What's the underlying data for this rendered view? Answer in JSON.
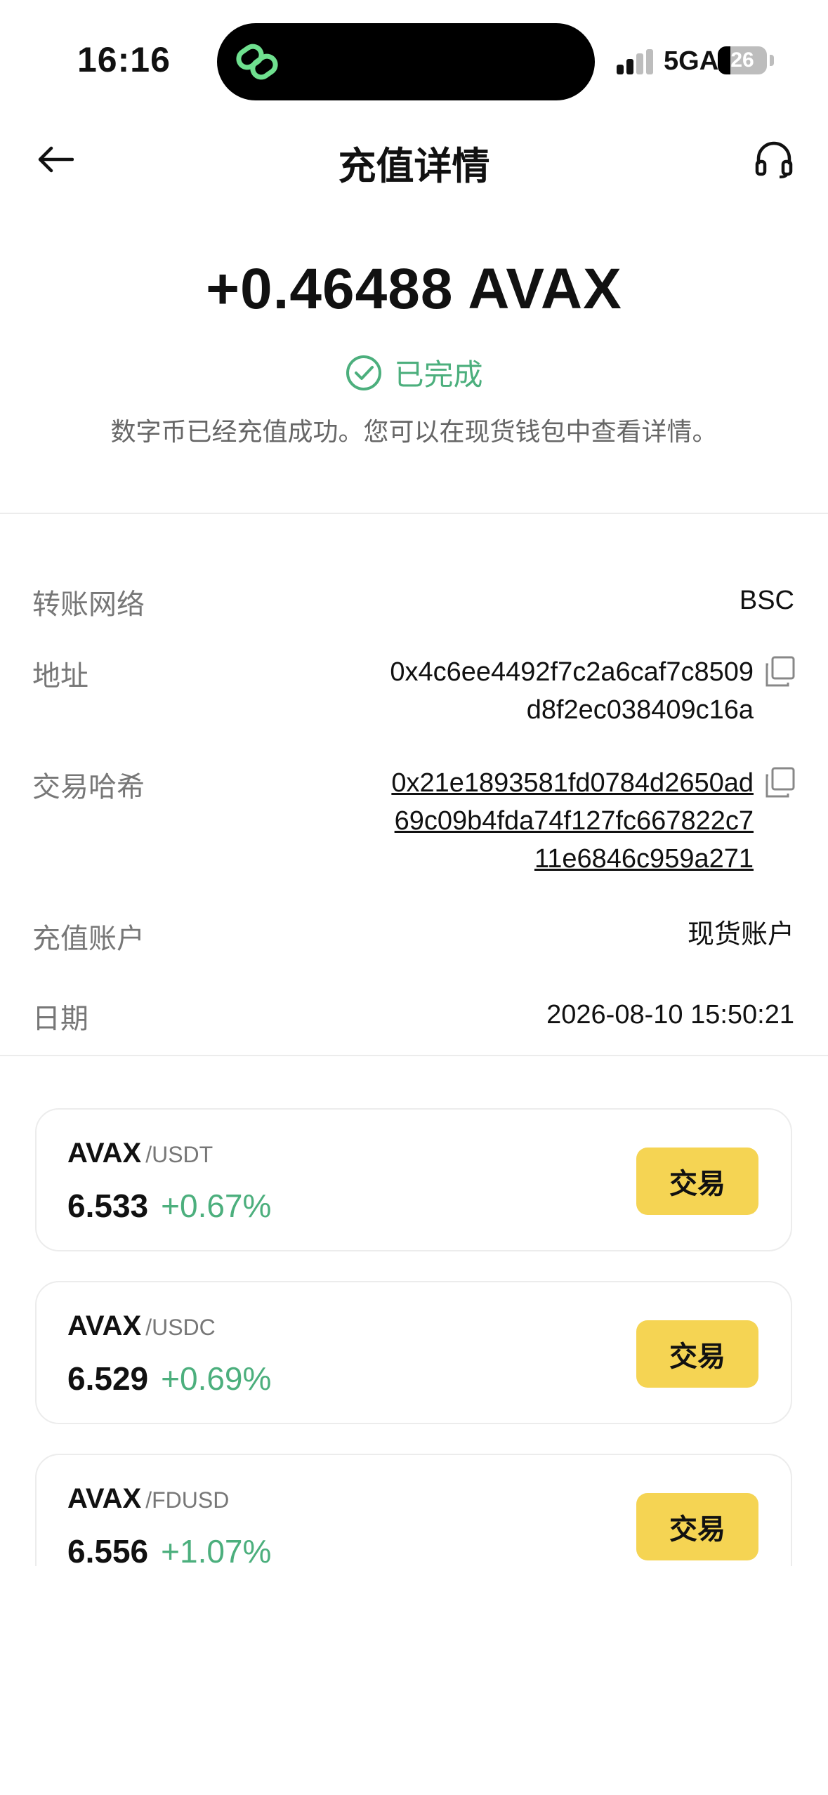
{
  "status_bar": {
    "time": "16:16",
    "network": "5GA",
    "battery": "26"
  },
  "header": {
    "title": "充值详情"
  },
  "summary": {
    "amount": "+0.46488 AVAX",
    "status": "已完成",
    "description": "数字币已经充值成功。您可以在现货钱包中查看详情。"
  },
  "details": {
    "network_label": "转账网络",
    "network_value": "BSC",
    "address_label": "地址",
    "address_line1": "0x4c6ee4492f7c2a6caf7c8509",
    "address_line2": "d8f2ec038409c16a",
    "hash_label": "交易哈希",
    "hash_line1": "0x21e1893581fd0784d2650ad",
    "hash_line2": "69c09b4fda74f127fc667822c7",
    "hash_line3": "11e6846c959a271",
    "account_label": "充值账户",
    "account_value": "现货账户",
    "date_label": "日期",
    "date_value": "2026-08-10 15:50:21"
  },
  "markets": [
    {
      "base": "AVAX",
      "quote": "/USDT",
      "price": "6.533",
      "change": "+0.67%",
      "button": "交易"
    },
    {
      "base": "AVAX",
      "quote": "/USDC",
      "price": "6.529",
      "change": "+0.69%",
      "button": "交易"
    },
    {
      "base": "AVAX",
      "quote": "/FDUSD",
      "price": "6.556",
      "change": "+1.07%",
      "button": "交易"
    }
  ],
  "colors": {
    "accent_green": "#4caf7d",
    "button_yellow": "#f5d453"
  }
}
